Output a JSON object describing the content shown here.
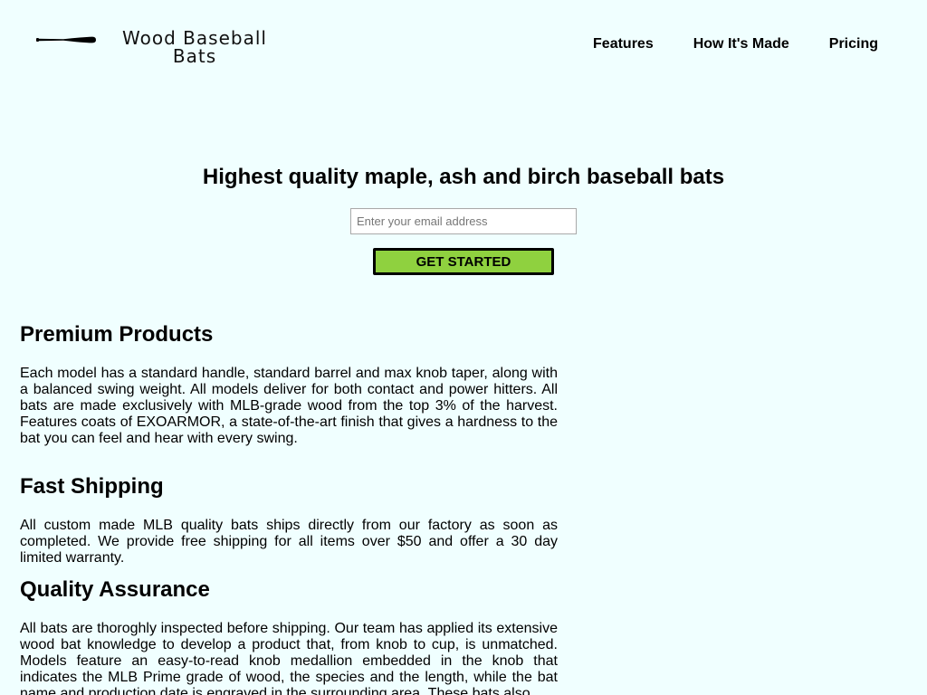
{
  "header": {
    "logo_text": "Wood Baseball Bats",
    "nav": [
      {
        "label": "Features"
      },
      {
        "label": "How It's Made"
      },
      {
        "label": "Pricing"
      }
    ]
  },
  "hero": {
    "title": "Highest quality maple, ash and birch baseball bats",
    "email_placeholder": "Enter your email address",
    "cta_label": "GET STARTED"
  },
  "sections": [
    {
      "title": "Premium Products",
      "body": "Each model has a standard handle, standard barrel and max knob taper, along with a balanced swing weight. All models deliver for both contact and power hitters. All bats are made exclusively with MLB-grade wood from the top 3% of the harvest. Features coats of EXOARMOR, a state-of-the-art finish that gives a hardness to the bat you can feel and hear with every swing."
    },
    {
      "title": "Fast Shipping",
      "body": "All custom made MLB quality bats ships directly from our factory as soon as completed. We provide free shipping for all items over $50 and offer a 30 day limited warranty."
    },
    {
      "title": "Quality Assurance",
      "body": "All bats are thoroghly inspected before shipping. Our team has applied its extensive wood bat knowledge to develop a product that, from knob to cup, is unmatched. Models feature an easy-to-read knob medallion embedded in the knob that indicates the MLB Prime grade of wood, the species and the length, while the bat name and production date is engraved in the surrounding area. These bats also"
    }
  ],
  "colors": {
    "background": "#f0ffff",
    "cta_background": "#8fd13f"
  },
  "icons": {
    "logo": "baseball-bat-icon"
  }
}
